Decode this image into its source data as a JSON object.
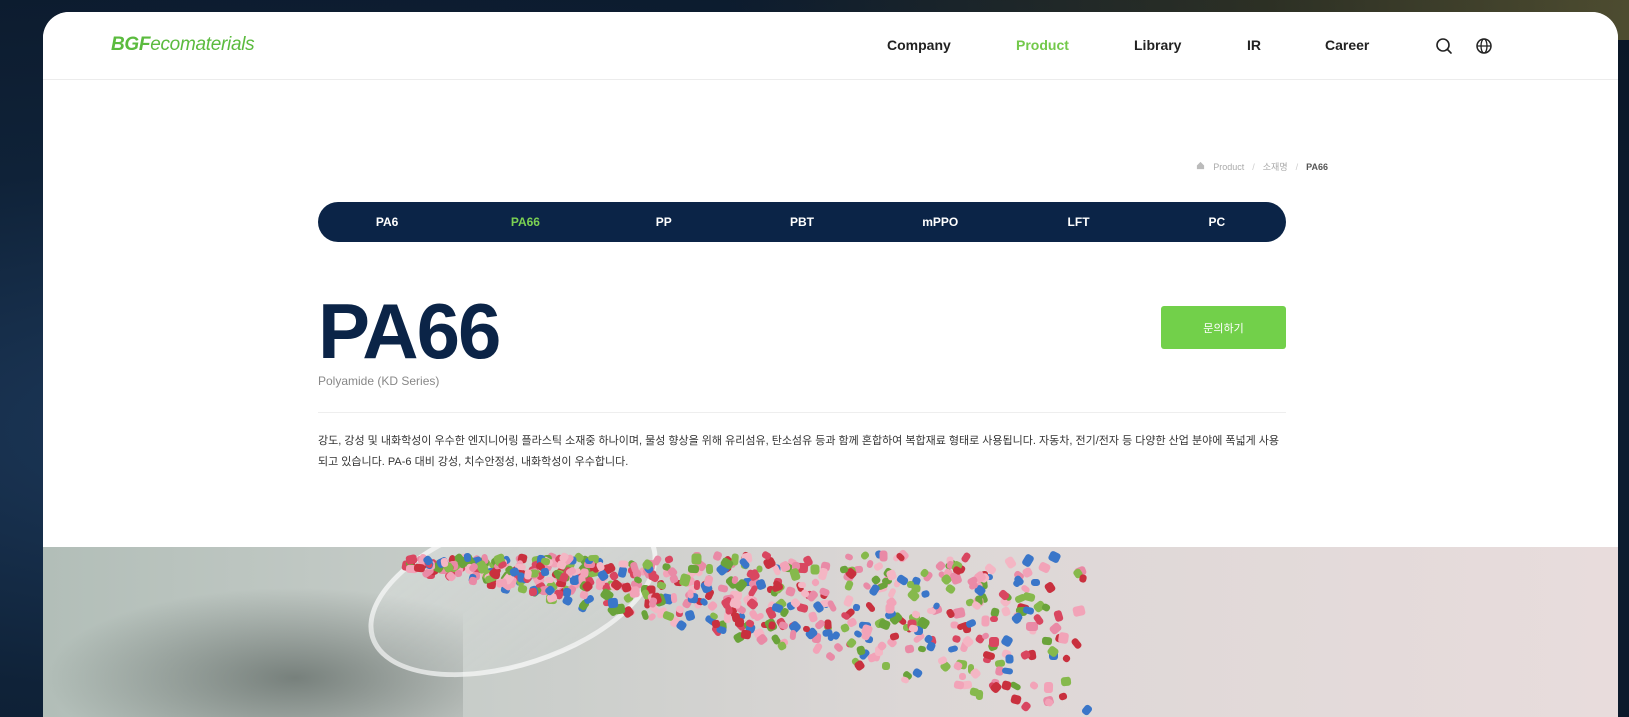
{
  "brand": {
    "logo_bold": "BGF",
    "logo_rest": "ecomaterials"
  },
  "nav": {
    "items": [
      {
        "label": "Company",
        "active": false
      },
      {
        "label": "Product",
        "active": true
      },
      {
        "label": "Library",
        "active": false
      },
      {
        "label": "IR",
        "active": false
      },
      {
        "label": "Career",
        "active": false
      }
    ],
    "icons": [
      "search-icon",
      "globe-icon"
    ]
  },
  "breadcrumb": {
    "home_icon": "home-icon",
    "items": [
      "Product",
      "소재명",
      "PA66"
    ]
  },
  "tabs": {
    "items": [
      "PA6",
      "PA66",
      "PP",
      "PBT",
      "mPPO",
      "LFT",
      "PC"
    ],
    "active_index": 1
  },
  "product": {
    "title": "PA66",
    "subtitle": "Polyamide (KD Series)",
    "button_label": "문의하기",
    "description": "강도, 강성 및 내화학성이 우수한 엔지니어링 플라스틱 소재중 하나이며, 물성 향상을 위해 유리섬유, 탄소섬유 등과 함께 혼합하여 복합재료 형태로 사용됩니다. 자동차, 전기/전자 등 다양한 산업 분야에 폭넓게 사용되고 있습니다. PA-6 대비 강성, 치수안정성, 내화학성이 우수합니다."
  },
  "colors": {
    "navy": "#0b2447",
    "accent_green": "#72d04a",
    "logo_green": "#5bbb3e",
    "background": "#0f2238"
  }
}
